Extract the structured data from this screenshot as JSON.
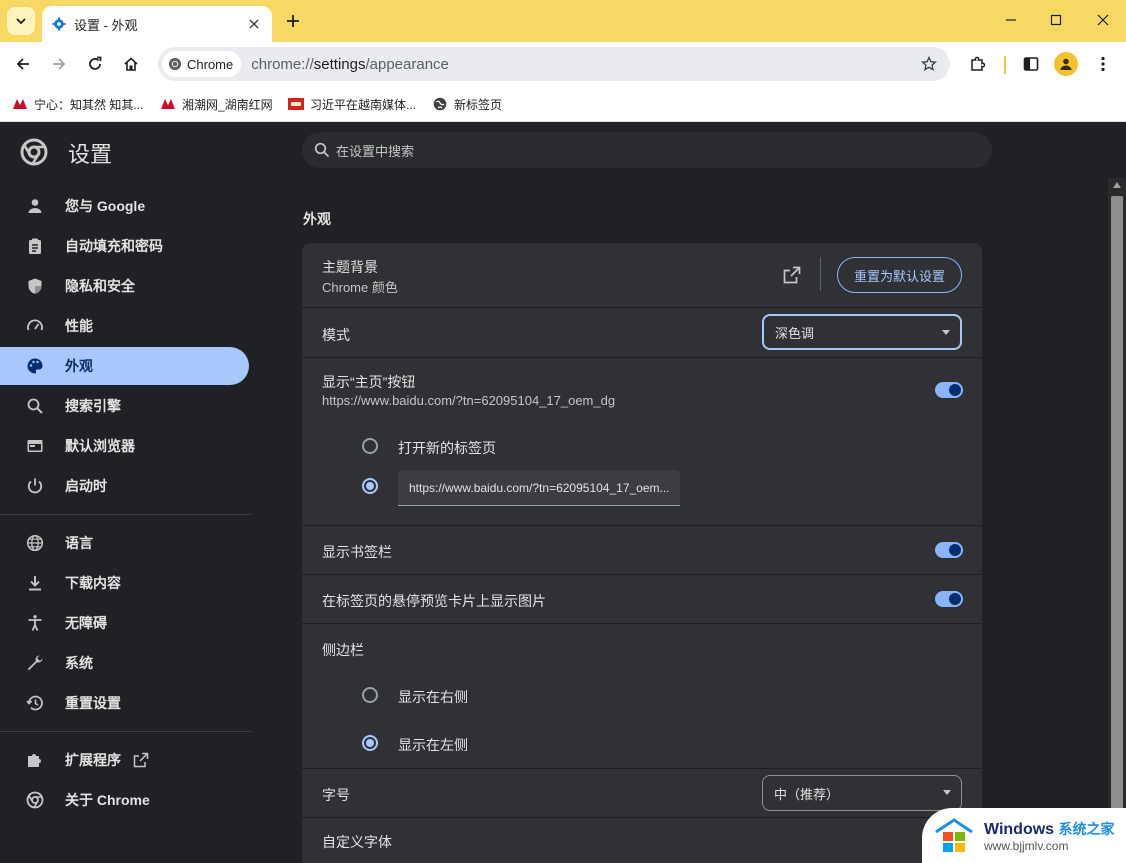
{
  "browser": {
    "tab_title": "设置 - 外观",
    "chip_label": "Chrome",
    "url_scheme": "chrome://",
    "url_host": "settings",
    "url_path": "/appearance"
  },
  "bookmarks": [
    {
      "label": "宁心：知其然 知其..."
    },
    {
      "label": "湘潮网_湖南红网"
    },
    {
      "label": "习近平在越南媒体..."
    },
    {
      "label": "新标签页"
    }
  ],
  "settings": {
    "title": "设置",
    "search_placeholder": "在设置中搜索",
    "nav": [
      {
        "label": "您与 Google",
        "icon": "person-icon"
      },
      {
        "label": "自动填充和密码",
        "icon": "clipboard-icon"
      },
      {
        "label": "隐私和安全",
        "icon": "shield-icon"
      },
      {
        "label": "性能",
        "icon": "speedometer-icon"
      },
      {
        "label": "外观",
        "icon": "palette-icon"
      },
      {
        "label": "搜索引擎",
        "icon": "search-icon"
      },
      {
        "label": "默认浏览器",
        "icon": "browser-window-icon"
      },
      {
        "label": "启动时",
        "icon": "power-icon"
      },
      {
        "label": "语言",
        "icon": "globe-icon"
      },
      {
        "label": "下载内容",
        "icon": "download-icon"
      },
      {
        "label": "无障碍",
        "icon": "accessibility-icon"
      },
      {
        "label": "系统",
        "icon": "wrench-icon"
      },
      {
        "label": "重置设置",
        "icon": "history-icon"
      },
      {
        "label": "扩展程序",
        "icon": "puzzle-icon"
      },
      {
        "label": "关于 Chrome",
        "icon": "chrome-icon"
      }
    ],
    "section_title": "外观",
    "theme": {
      "label": "主题背景",
      "sub": "Chrome 颜色",
      "reset_button": "重置为默认设置"
    },
    "mode": {
      "label": "模式",
      "value": "深色调"
    },
    "home_button": {
      "label": "显示“主页”按钮",
      "sub": "https://www.baidu.com/?tn=62095104_17_oem_dg",
      "enabled": true,
      "option_newtab": "打开新的标签页",
      "option_url_value": "https://www.baidu.com/?tn=62095104_17_oem..."
    },
    "bookmarks_bar": {
      "label": "显示书签栏",
      "enabled": true
    },
    "hover_preview": {
      "label": "在标签页的悬停预览卡片上显示图片",
      "enabled": true
    },
    "side_panel": {
      "label": "侧边栏",
      "option_right": "显示在右侧",
      "option_left": "显示在左侧",
      "selected": "left"
    },
    "font_size": {
      "label": "字号",
      "value": "中（推荐）"
    },
    "custom_fonts": {
      "label": "自定义字体"
    }
  },
  "watermark": {
    "brand": "Windows",
    "brand_cn": "系统之家",
    "site": "www.bjjmlv.com"
  },
  "colors": {
    "titlebar": "#f6d965",
    "accent": "#a8c7fa",
    "page_bg": "#202124",
    "card_bg": "#303134"
  }
}
